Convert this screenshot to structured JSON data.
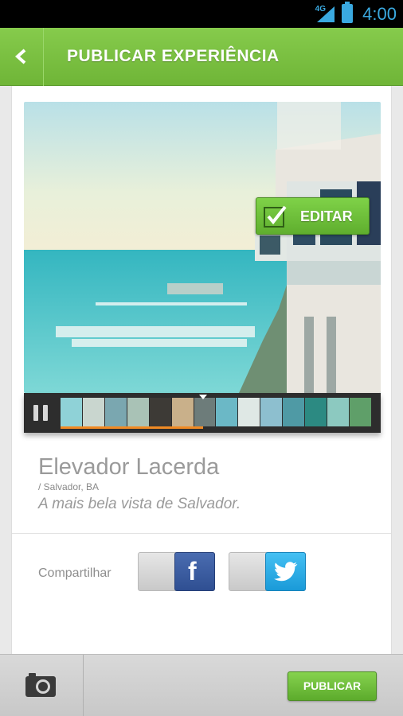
{
  "status_bar": {
    "network": "4G",
    "time": "4:00"
  },
  "header": {
    "title": "PUBLICAR EXPERIÊNCIA",
    "back_icon": "chevron-left-icon"
  },
  "media": {
    "edit_label": "EDITAR",
    "edit_icon": "edit-icon",
    "player": {
      "state_icon": "pause-icon",
      "progress_fraction": 0.46
    },
    "thumbnail_colors": [
      "#8fd2d7",
      "#c9d6cf",
      "#7aa7b0",
      "#a9c2b6",
      "#3d3a36",
      "#c9b08a",
      "#6d7c7a",
      "#6bb8c6",
      "#dfe8e5",
      "#8dbfcf",
      "#4f9aa5",
      "#2c8a82",
      "#8cc9c0",
      "#5f9f69"
    ]
  },
  "place": {
    "title": "Elevador Lacerda",
    "location": "/ Salvador, BA",
    "description": "A mais bela vista de Salvador."
  },
  "share": {
    "label": "Compartilhar",
    "facebook_glyph": "f",
    "facebook_icon": "facebook-icon",
    "twitter_icon": "twitter-bird-icon"
  },
  "bottom_bar": {
    "camera_icon": "camera-icon",
    "publish_label": "PUBLICAR"
  },
  "colors": {
    "accent_green": "#7dc444",
    "facebook_blue": "#3b5998",
    "twitter_blue": "#1da1f2",
    "status_blue": "#3aa9e0"
  }
}
